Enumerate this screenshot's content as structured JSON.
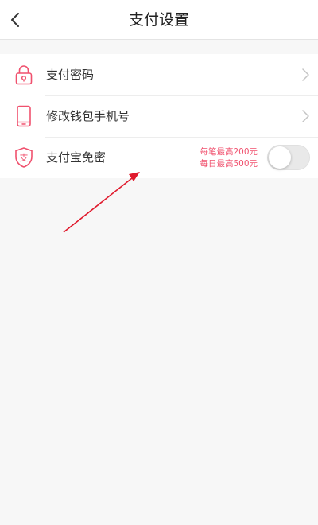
{
  "header": {
    "title": "支付设置",
    "back_icon": "back-arrow-icon"
  },
  "settings": {
    "items": [
      {
        "label": "支付密码",
        "icon": "lock-icon",
        "has_chevron": true
      },
      {
        "label": "修改钱包手机号",
        "icon": "phone-icon",
        "has_chevron": true
      },
      {
        "label": "支付宝免密",
        "icon": "alipay-shield-icon",
        "icon_text": "支",
        "limit_per_transaction": "每笔最高200元",
        "limit_per_day": "每日最高500元",
        "toggle_on": false
      }
    ]
  },
  "colors": {
    "accent": "#f0516e",
    "annotation_arrow": "#e0192c",
    "background": "#f7f7f7"
  }
}
